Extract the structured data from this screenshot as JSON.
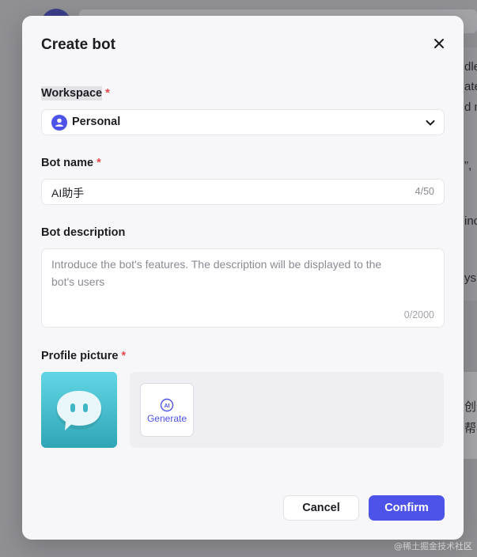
{
  "dialog": {
    "title": "Create bot"
  },
  "workspace": {
    "label": "Workspace",
    "required_mark": "*",
    "selected": "Personal"
  },
  "bot_name": {
    "label": "Bot name",
    "required_mark": "*",
    "value": "AI助手",
    "counter": "4/50"
  },
  "bot_description": {
    "label": "Bot description",
    "placeholder": "Introduce the bot's features. The description will be displayed to the bot's users",
    "counter": "0/2000"
  },
  "profile_picture": {
    "label": "Profile picture",
    "required_mark": "*",
    "generate_label": "Generate",
    "generate_icon_text": "AI"
  },
  "footer": {
    "cancel_label": "Cancel",
    "confirm_label": "Confirm"
  },
  "background": {
    "fragments": [
      "dle",
      "ate",
      "d n",
      "”,",
      "inc",
      "ys",
      "创造",
      "帮我"
    ]
  },
  "watermark": "@稀土掘金技术社区",
  "colors": {
    "accent": "#4d53e8",
    "required": "#e5484d",
    "overlay": "#8f8f94"
  }
}
